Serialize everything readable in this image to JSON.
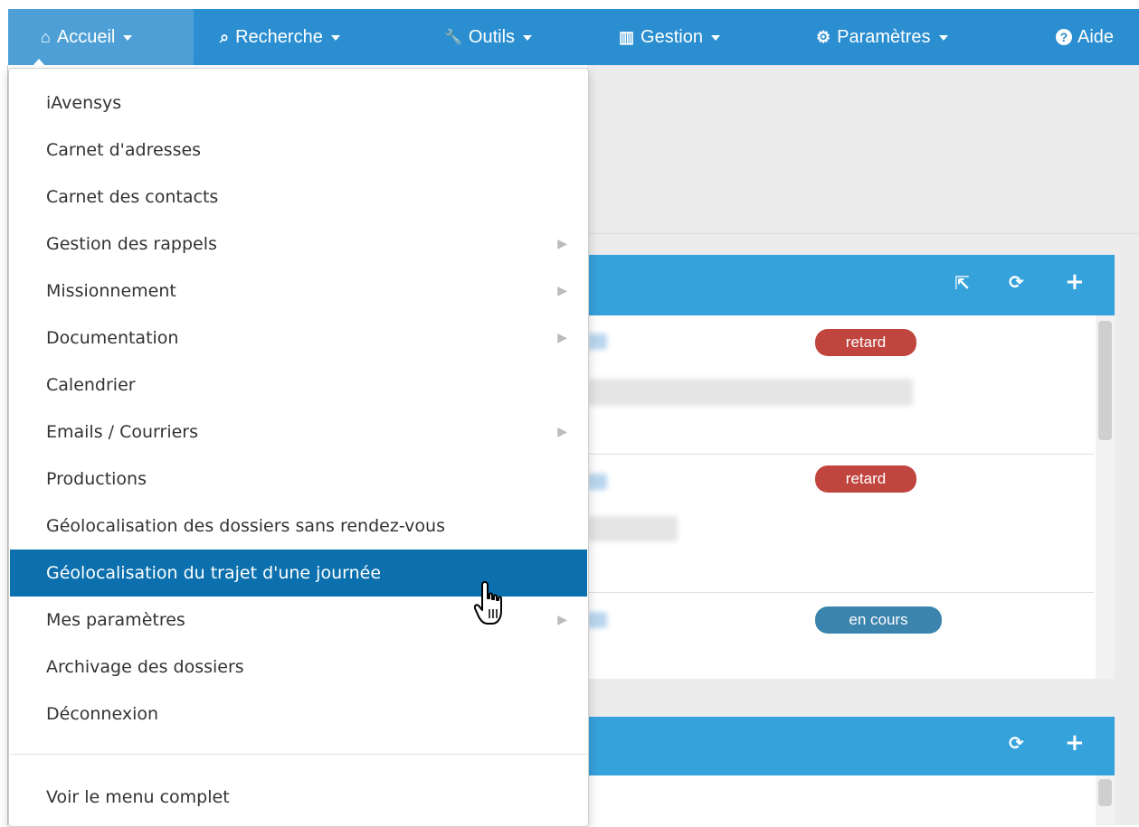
{
  "nav": {
    "items": [
      {
        "label": "Accueil",
        "icon": "home-icon",
        "glyph": "⌂"
      },
      {
        "label": "Recherche",
        "icon": "search-icon",
        "glyph": "⌕"
      },
      {
        "label": "Outils",
        "icon": "wrench-icon",
        "glyph": "🔧"
      },
      {
        "label": "Gestion",
        "icon": "bar-chart-icon",
        "glyph": "▥"
      },
      {
        "label": "Paramètres",
        "icon": "gears-icon",
        "glyph": "⚙"
      },
      {
        "label": "Aide",
        "icon": "question-circle-icon",
        "glyph": "?"
      }
    ]
  },
  "menu": {
    "items": [
      {
        "label": "iAvensys",
        "submenu": false
      },
      {
        "label": "Carnet d'adresses",
        "submenu": false
      },
      {
        "label": "Carnet des contacts",
        "submenu": false
      },
      {
        "label": "Gestion des rappels",
        "submenu": true
      },
      {
        "label": "Missionnement",
        "submenu": true
      },
      {
        "label": "Documentation",
        "submenu": true
      },
      {
        "label": "Calendrier",
        "submenu": false
      },
      {
        "label": "Emails / Courriers",
        "submenu": true
      },
      {
        "label": "Productions",
        "submenu": false
      },
      {
        "label": "Géolocalisation des dossiers sans rendez-vous",
        "submenu": false
      },
      {
        "label": "Géolocalisation du trajet d'une journée",
        "submenu": false,
        "active": true
      },
      {
        "label": "Mes paramètres",
        "submenu": true
      },
      {
        "label": "Archivage des dossiers",
        "submenu": false
      },
      {
        "label": "Déconnexion",
        "submenu": false
      }
    ],
    "footer_item": "Voir le menu complet",
    "submenu_glyph": "▶"
  },
  "panels": {
    "first": {
      "icons": [
        {
          "name": "share-icon",
          "glyph": "⇱"
        },
        {
          "name": "refresh-icon",
          "glyph": "⟳"
        },
        {
          "name": "plus-icon",
          "glyph": "+"
        }
      ],
      "badges": [
        "retard",
        "retard",
        "en cours"
      ]
    },
    "second": {
      "icons": [
        {
          "name": "refresh-icon",
          "glyph": "⟳"
        },
        {
          "name": "plus-icon",
          "glyph": "+"
        }
      ]
    }
  },
  "colors": {
    "navbar": "#2a8ed0",
    "panel_header": "#36a2db",
    "menu_active": "#0b70ad",
    "badge_retard": "#c0453e",
    "badge_en_cours": "#3a84ad"
  }
}
